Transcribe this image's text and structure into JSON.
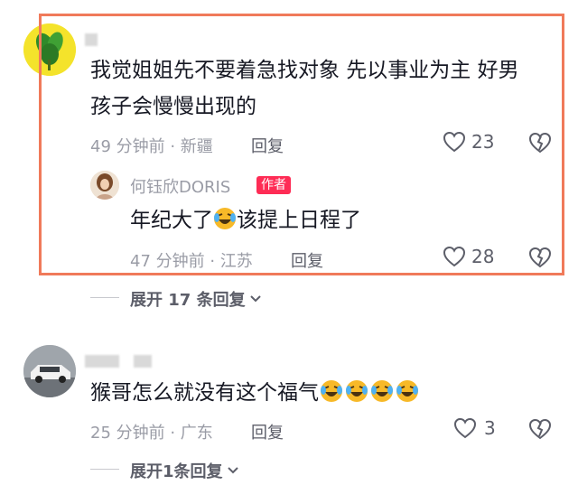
{
  "comments": [
    {
      "text_line1": "我觉姐姐先不要着急找对象  先以事业为主  好男",
      "text_line2": "孩子会慢慢出现的",
      "meta": "49 分钟前 · 新疆",
      "reply_label": "回复",
      "like_count": "23",
      "reply": {
        "username": "何钰欣DORIS",
        "badge": "作者",
        "text_before": "年纪大了",
        "text_after": "该提上日程了",
        "meta": "47 分钟前 · 江苏",
        "reply_label": "回复",
        "like_count": "28"
      },
      "expand_label": "展开 17 条回复"
    },
    {
      "text": "猴哥怎么就没有这个福气",
      "meta": "25 分钟前 · 广东",
      "reply_label": "回复",
      "like_count": "3",
      "expand_label": "展开1条回复"
    }
  ],
  "colors": {
    "highlight": "#f07a5a",
    "badge": "#fe2c55",
    "meta": "#9a9ca6"
  },
  "icons": [
    "heart-icon",
    "dislike-heart-icon",
    "chevron-down-icon",
    "laughing-crying-emoji"
  ]
}
